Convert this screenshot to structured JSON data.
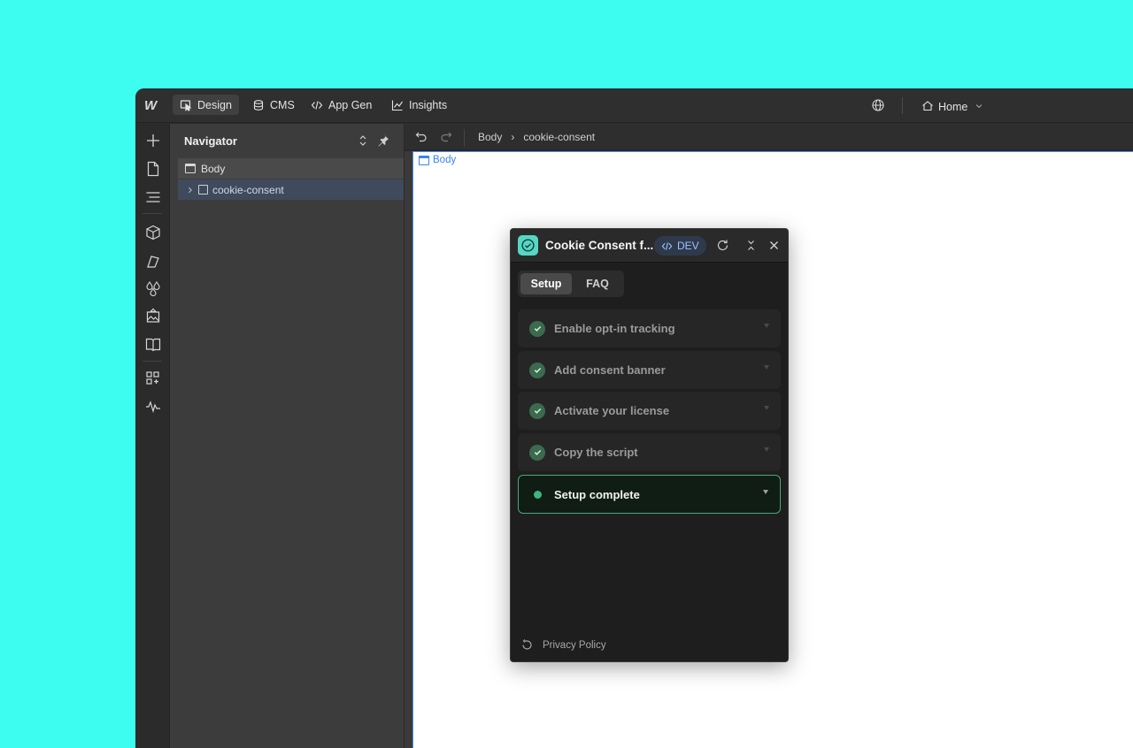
{
  "topbar": {
    "logo": "W",
    "tabs": [
      {
        "label": "Design",
        "icon": "cursor-icon"
      },
      {
        "label": "CMS",
        "icon": "database-icon"
      },
      {
        "label": "App Gen",
        "icon": "code-icon"
      },
      {
        "label": "Insights",
        "icon": "chart-icon"
      }
    ],
    "page_selector": "Home"
  },
  "navigator": {
    "title": "Navigator",
    "rows": [
      {
        "label": "Body"
      },
      {
        "label": "cookie-consent"
      }
    ]
  },
  "breadcrumb": {
    "items": [
      "Body",
      "cookie-consent"
    ],
    "separator": "›"
  },
  "canvas": {
    "label": "Body"
  },
  "panel": {
    "title": "Cookie Consent f...",
    "badge": "DEV",
    "tabs": [
      "Setup",
      "FAQ"
    ],
    "steps": [
      {
        "label": "Enable opt-in tracking",
        "status": "done"
      },
      {
        "label": "Add consent banner",
        "status": "done"
      },
      {
        "label": "Activate your license",
        "status": "done"
      },
      {
        "label": "Copy the script",
        "status": "done"
      },
      {
        "label": "Setup complete",
        "status": "current"
      }
    ],
    "footer_link": "Privacy Policy"
  },
  "colors": {
    "background": "#3cfdf0",
    "accent_blue": "#3b82f6",
    "success_green": "#3eb57a"
  }
}
